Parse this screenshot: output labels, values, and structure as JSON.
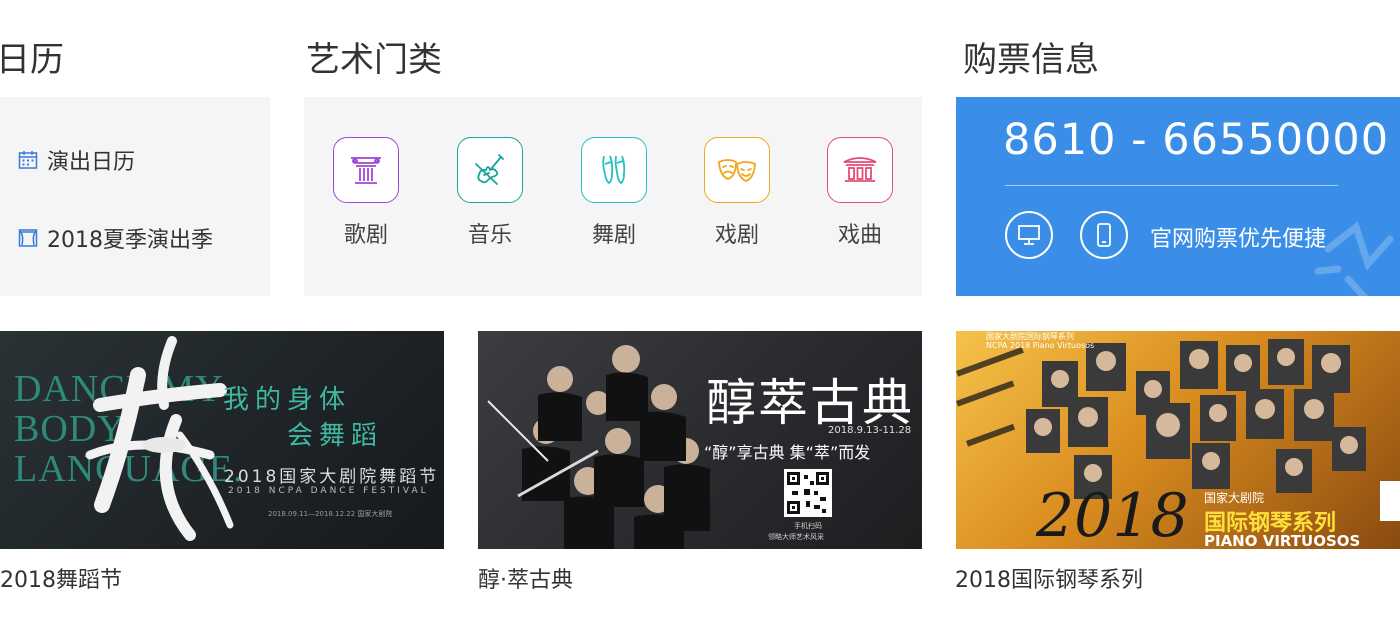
{
  "calendar": {
    "title": "日历",
    "items": [
      {
        "label": "演出日历",
        "icon": "calendar-icon"
      },
      {
        "label": "2018夏季演出季",
        "icon": "stage-curtain-icon"
      }
    ]
  },
  "art": {
    "title": "艺术门类",
    "items": [
      {
        "label": "歌剧",
        "icon": "opera-column-icon",
        "color": "#a046d4"
      },
      {
        "label": "音乐",
        "icon": "violin-icon",
        "color": "#1aa39a"
      },
      {
        "label": "舞剧",
        "icon": "ballet-shoes-icon",
        "color": "#22c2c2"
      },
      {
        "label": "戏剧",
        "icon": "drama-masks-icon",
        "color": "#f0a81e"
      },
      {
        "label": "戏曲",
        "icon": "chinese-pavilion-icon",
        "color": "#e44d76"
      }
    ]
  },
  "ticket": {
    "title": "购票信息",
    "phone": "8610 - 66550000",
    "text": "官网购票优先便捷",
    "bg_color": "#3a8ee8",
    "icons": [
      "desktop-icon",
      "mobile-phone-icon"
    ]
  },
  "banners": [
    {
      "caption": "2018舞蹈节",
      "art": {
        "big_letters": "DANCE MY BODY LANGUAGE.",
        "char": "我",
        "line1": "我的身体",
        "line2": "会舞蹈",
        "festival": "2018国家大剧院舞蹈节",
        "festival_en": "2018 NCPA DANCE FESTIVAL",
        "dates": "2018.09.11—2018.12.22 国家大剧院"
      }
    },
    {
      "caption": "醇·萃古典",
      "art": {
        "title": "醇萃古典",
        "dates": "2018.9.13-11.28",
        "slogan": "“醇”享古典 集“萃”而发",
        "qr_caption1": "手机扫码",
        "qr_caption2": "领略大师艺术风采"
      }
    },
    {
      "caption": "2018国际钢琴系列",
      "art": {
        "top": "国家大剧院国际钢琴系列",
        "top_en": "NCPA 2018 Piano Virtuosos",
        "year": "2018",
        "label1": "国家大剧院",
        "label2": "国际钢琴系列",
        "label3": "PIANO VIRTUOSOS"
      }
    }
  ]
}
